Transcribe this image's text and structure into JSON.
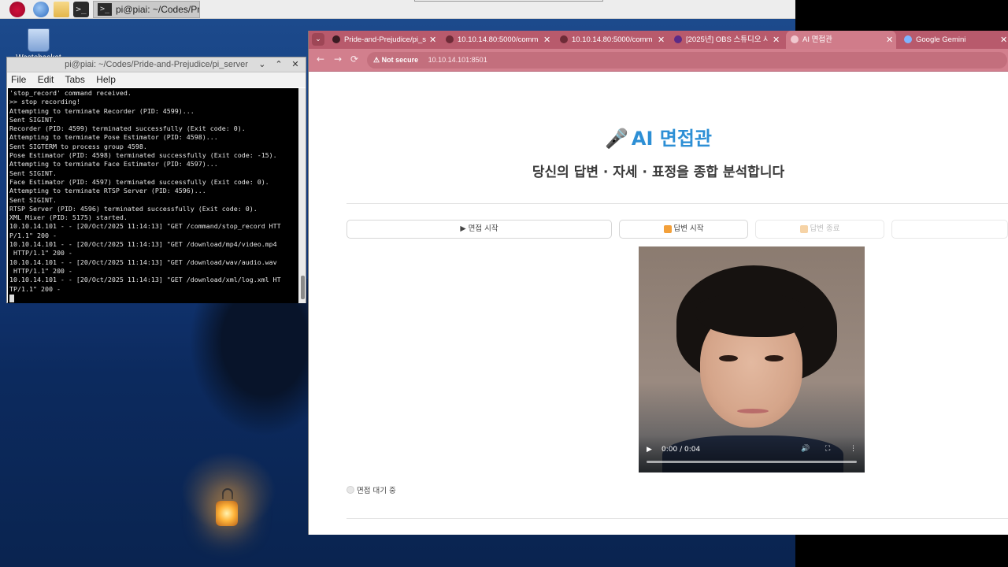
{
  "desktop": {
    "wastebasket_label": "Wastebasket"
  },
  "panel": {
    "terminal_glyph": ">_",
    "task_title": "pi@piai: ~/Codes/Pri..."
  },
  "terminal": {
    "window_title": "pi@piai: ~/Codes/Pride-and-Prejudice/pi_server",
    "controls": [
      "⌄",
      "⌃",
      "✕"
    ],
    "menu": [
      "File",
      "Edit",
      "Tabs",
      "Help"
    ],
    "lines": [
      "'stop_record' command received.",
      ">> stop recording!",
      "Attempting to terminate Recorder (PID: 4599)...",
      "Sent SIGINT.",
      "Recorder (PID: 4599) terminated successfully (Exit code: 0).",
      "Attempting to terminate Pose Estimator (PID: 4598)...",
      "Sent SIGTERM to process group 4598.",
      "Pose Estimator (PID: 4598) terminated successfully (Exit code: -15).",
      "Attempting to terminate Face Estimator (PID: 4597)...",
      "Sent SIGINT.",
      "Face Estimator (PID: 4597) terminated successfully (Exit code: 0).",
      "Attempting to terminate RTSP Server (PID: 4596)...",
      "Sent SIGINT.",
      "RTSP Server (PID: 4596) terminated successfully (Exit code: 0).",
      "XML Mixer (PID: 5175) started.",
      "10.10.14.101 - - [20/Oct/2025 11:14:13] \"GET /command/stop_record HTT",
      "P/1.1\" 200 -",
      "10.10.14.101 - - [20/Oct/2025 11:14:13] \"GET /download/mp4/video.mp4",
      " HTTP/1.1\" 200 -",
      "10.10.14.101 - - [20/Oct/2025 11:14:13] \"GET /download/wav/audio.wav",
      " HTTP/1.1\" 200 -",
      "10.10.14.101 - - [20/Oct/2025 11:14:13] \"GET /download/xml/log.xml HT",
      "TP/1.1\" 200 -"
    ]
  },
  "browser": {
    "tab_menu_glyph": "⌄",
    "close_glyph": "✕",
    "tabs": [
      {
        "label": "Pride-and-Prejudice/pi_s"
      },
      {
        "label": "10.10.14.80:5000/comm"
      },
      {
        "label": "10.10.14.80:5000/comm"
      },
      {
        "label": "[2025년] OBS 스튜디오 사"
      },
      {
        "label": "AI 면접관"
      },
      {
        "label": "Google Gemini"
      }
    ],
    "nav": {
      "back": "←",
      "forward": "→",
      "reload": "⟳"
    },
    "security_label": "Not secure",
    "url": "10.10.14.101:8501",
    "accent": "#2d8fd5"
  },
  "app": {
    "title_icon": "🎤",
    "title": "AI 면접관",
    "subtitle": "당신의 답변 · 자세 · 표정을 종합 분석합니다",
    "buttons": [
      {
        "label": "▶ 면접 시작",
        "enabled": true
      },
      {
        "label": "답변 시작",
        "enabled": true
      },
      {
        "label": "답변 종료",
        "enabled": false
      },
      {
        "label": "",
        "enabled": false
      }
    ],
    "video": {
      "time": "0:00 / 0:04",
      "play_glyph": "▶",
      "volume_glyph": "🔊",
      "fullscreen_glyph": "⛶",
      "more_glyph": "⋮",
      "progress": 0.0
    },
    "status": "면접 대기 중"
  }
}
